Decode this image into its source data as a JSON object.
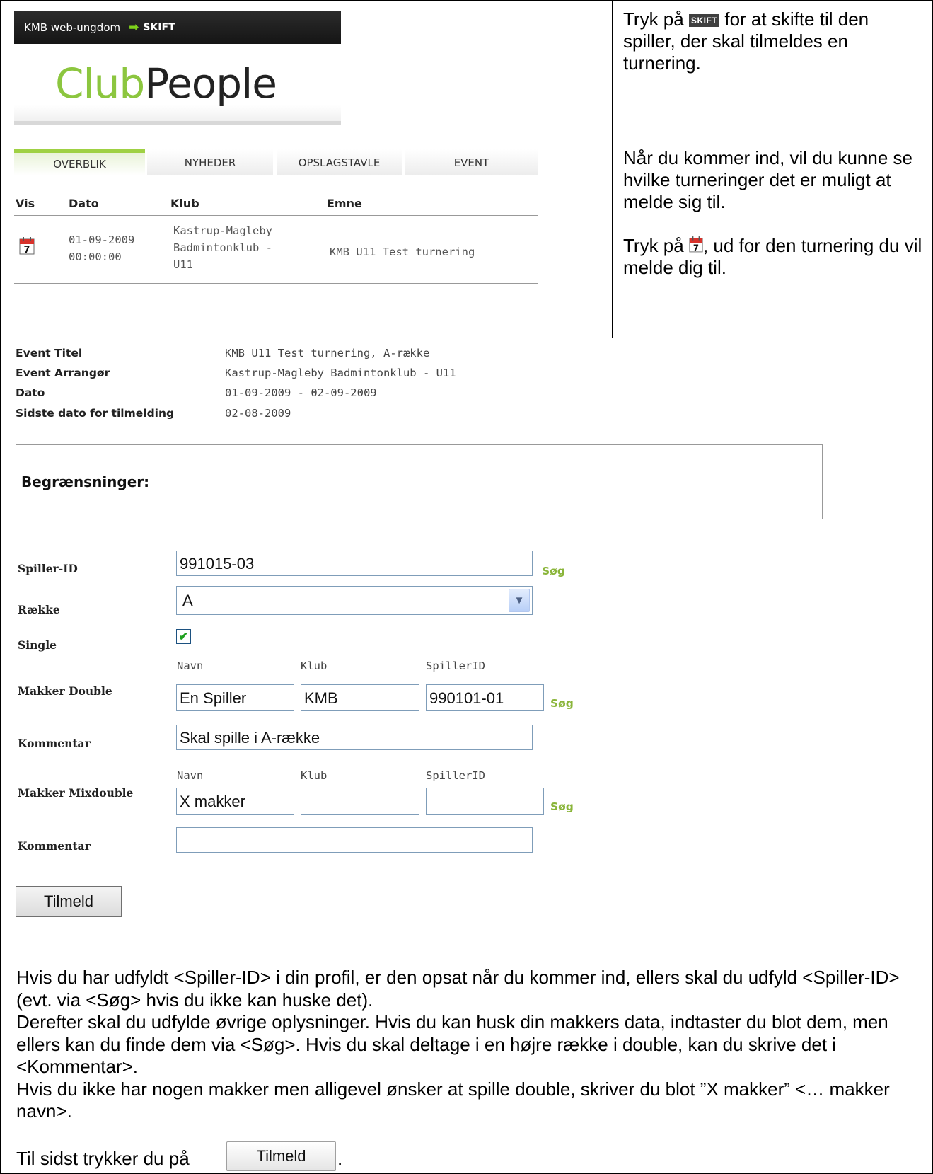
{
  "header": {
    "org_name": "KMB web-ungdom",
    "switch_label": "SKIFT",
    "logo_club": "Club",
    "logo_people": "People"
  },
  "instructions": {
    "step1_prefix": "Tryk på ",
    "step1_badge": "SKIFT",
    "step1_suffix": " for at skifte til den spiller, der skal tilmeldes en turnering.",
    "step2_para1": "Når du kommer ind, vil du kunne se hvilke turneringer det er muligt at melde sig til.",
    "step2_prefix": "Tryk på ",
    "step2_suffix": ", ud for den turnering du vil melde dig til."
  },
  "tabs": [
    "OVERBLIK",
    "NYHEDER",
    "OPSLAGSTAVLE",
    "EVENT"
  ],
  "event_list": {
    "columns": [
      "Vis",
      "Dato",
      "Klub",
      "Emne"
    ],
    "row": {
      "date_line1": "01-09-2009",
      "date_line2": "00:00:00",
      "club_line1": "Kastrup-Magleby",
      "club_line2": "Badmintonklub -",
      "club_line3": "U11",
      "subject": "KMB U11 Test turnering"
    }
  },
  "event_detail": {
    "title_label": "Event Titel",
    "title_value": "KMB U11 Test turnering, A-række",
    "organizer_label": "Event Arrangør",
    "organizer_value": "Kastrup-Magleby Badmintonklub - U11",
    "date_label": "Dato",
    "date_value": "01-09-2009 - 02-09-2009",
    "deadline_label": "Sidste dato for tilmelding",
    "deadline_value": "02-08-2009",
    "restrictions_label": "Begrænsninger:"
  },
  "form": {
    "player_id_label": "Spiller-ID",
    "player_id_value": "991015-03",
    "search_label": "Søg",
    "row_label": "Række",
    "row_value": "A",
    "single_label": "Single",
    "single_checked": true,
    "double_label": "Makker Double",
    "mix_label": "Makker Mixdouble",
    "sub_name": "Navn",
    "sub_club": "Klub",
    "sub_id": "SpillerID",
    "double_name": "En Spiller",
    "double_club": "KMB",
    "double_id": "990101-01",
    "comment_label": "Kommentar",
    "double_comment": "Skal spille i A-række",
    "mix_name": "X makker",
    "mix_club": "",
    "mix_id": "",
    "mix_comment": "",
    "submit_label": "Tilmeld"
  },
  "explanation": {
    "p1": "Hvis du har udfyldt <Spiller-ID> i din profil, er den opsat når du kommer ind, ellers skal du udfyld <Spiller-ID> (evt. via <Søg> hvis du ikke kan huske det).",
    "p2": "Derefter skal du udfylde øvrige oplysninger. Hvis du kan husk din makkers data, indtaster du blot dem, men ellers kan du finde dem via <Søg>. Hvis du skal deltage i en højre række i double, kan du skrive det i <Kommentar>.",
    "p3": "Hvis du ikke har nogen makker men alligevel ønsker at spille double, skriver du blot ”X makker” <… makker navn>.",
    "final_prefix": "Til sidst trykker du på",
    "final_button": "Tilmeld",
    "final_suffix": "."
  }
}
